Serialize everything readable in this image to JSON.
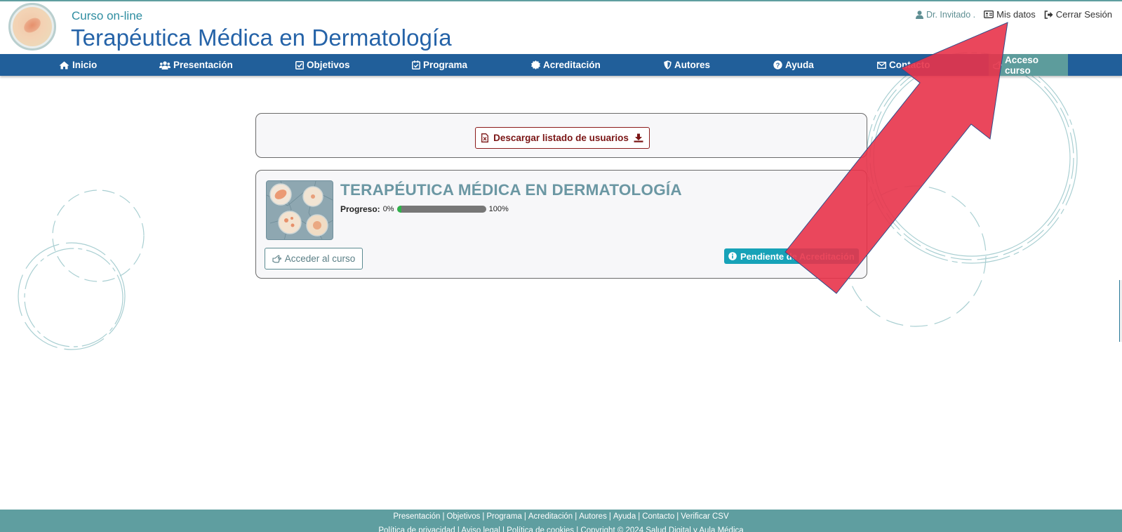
{
  "header": {
    "subtitle": "Curso on-line",
    "title": "Terapéutica Médica en Dermatología",
    "user_name": "Dr. Invitado .",
    "my_data_label": "Mis datos",
    "logout_label": "Cerrar Sesión"
  },
  "nav": {
    "items": [
      {
        "label": "Inicio",
        "icon": "home-icon"
      },
      {
        "label": "Presentación",
        "icon": "users-icon"
      },
      {
        "label": "Objetivos",
        "icon": "checkbox-icon"
      },
      {
        "label": "Programa",
        "icon": "calendar-check-icon"
      },
      {
        "label": "Acreditación",
        "icon": "certificate-icon"
      },
      {
        "label": "Autores",
        "icon": "shield-icon"
      },
      {
        "label": "Ayuda",
        "icon": "question-icon"
      },
      {
        "label": "Contacto",
        "icon": "envelope-icon"
      },
      {
        "label": "Acceso curso",
        "icon": "hand-pointer-icon",
        "active": true
      }
    ]
  },
  "download": {
    "label": "Descargar listado de usuarios"
  },
  "course": {
    "title": "TERAPÉUTICA MÉDICA EN DERMATOLOGÍA",
    "progress_label": "Progreso:",
    "progress_min": "0%",
    "progress_max": "100%",
    "progress_value": 0.05,
    "access_button": "Acceder al curso",
    "status_badge": "Pendiente de Acreditación"
  },
  "footer": {
    "links": [
      "Presentación",
      "Objetivos",
      "Programa",
      "Acreditación",
      "Autores",
      "Ayuda",
      "Contacto",
      "Verificar CSV"
    ],
    "legal": "Política de privacidad | Aviso legal | Política de cookies | Copyright © 2024 Salud Digital y Aula Médica"
  },
  "colors": {
    "nav_bg": "#215f9a",
    "nav_active": "#5d9c9c",
    "title": "#2563a8",
    "footer_bg": "#5f9ea0",
    "badge": "#17a2b8",
    "download_border": "#8b1a1a",
    "annotation_arrow": "#e8334a"
  }
}
